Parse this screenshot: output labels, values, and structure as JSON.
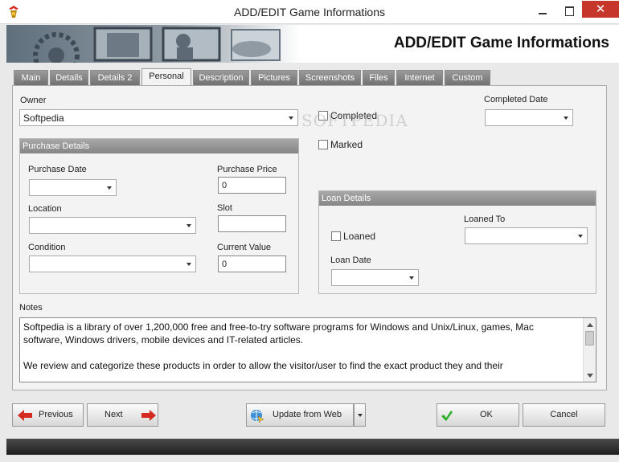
{
  "window": {
    "title": "ADD/EDIT Game Informations",
    "close_glyph": "✕"
  },
  "banner": {
    "heading": "ADD/EDIT Game Informations"
  },
  "tabs": [
    {
      "label": "Main"
    },
    {
      "label": "Details"
    },
    {
      "label": "Details 2"
    },
    {
      "label": "Personal",
      "active": true
    },
    {
      "label": "Description"
    },
    {
      "label": "Pictures"
    },
    {
      "label": "Screenshots"
    },
    {
      "label": "Files"
    },
    {
      "label": "Internet"
    },
    {
      "label": "Custom"
    }
  ],
  "personal": {
    "owner_label": "Owner",
    "owner_value": "Softpedia",
    "completed_label": "Completed",
    "marked_label": "Marked",
    "completed_date_label": "Completed Date",
    "completed_date_value": "",
    "watermark": "SOFTPEDIA"
  },
  "purchase": {
    "header": "Purchase Details",
    "purchase_date_label": "Purchase Date",
    "purchase_date_value": "",
    "location_label": "Location",
    "location_value": "",
    "condition_label": "Condition",
    "condition_value": "",
    "purchase_price_label": "Purchase Price",
    "purchase_price_value": "0",
    "slot_label": "Slot",
    "slot_value": "",
    "current_value_label": "Current Value",
    "current_value_value": "0"
  },
  "loan": {
    "header": "Loan Details",
    "loaned_label": "Loaned",
    "loaned_to_label": "Loaned To",
    "loaned_to_value": "",
    "loan_date_label": "Loan Date",
    "loan_date_value": ""
  },
  "notes": {
    "label": "Notes",
    "lines": [
      "Softpedia is a library of over 1,200,000 free and free-to-try software programs for Windows and Unix/Linux, games, Mac",
      "software, Windows drivers, mobile devices and IT-related articles.",
      "",
      "We review and categorize these products in order to allow the visitor/user to find the exact product they and their"
    ]
  },
  "buttons": {
    "previous": "Previous",
    "next": "Next",
    "update": "Update from Web",
    "ok": "OK",
    "cancel": "Cancel"
  },
  "icons": {
    "app": "game-app-icon",
    "previous": "red-arrow-left-icon",
    "next": "red-arrow-right-icon",
    "update": "web-globe-icon",
    "ok": "green-check-icon"
  },
  "colors": {
    "close_button": "#c7362b",
    "tab_inactive": "#7f7f7f",
    "group_header": "#959595",
    "arrow_red": "#d42a20",
    "check_green": "#2fae2a",
    "footer_bar": "#2e2e2e"
  }
}
